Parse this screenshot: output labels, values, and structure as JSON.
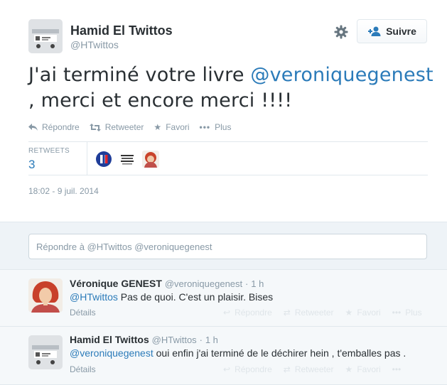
{
  "tweet": {
    "author_name": "Hamid El Twittos",
    "author_handle": "@HTwittos",
    "follow_label": "Suivre",
    "text_before": "J'ai terminé votre livre ",
    "text_mention": "@veroniquegenest",
    "text_after": " , merci et encore merci !!!!",
    "actions": {
      "reply": "Répondre",
      "retweet": "Retweeter",
      "favorite": "Favori",
      "more": "Plus"
    },
    "retweets_label": "RETWEETS",
    "retweets_count": "3",
    "timestamp": "18:02 - 9 juil. 2014"
  },
  "reply_box": {
    "prefix": "Répondre à ",
    "mentions": "@HTwittos @veroniquegenest"
  },
  "replies": [
    {
      "name": "Véronique GENEST",
      "handle": "@veroniquegenest",
      "time": "1 h",
      "mention": "@HTwittos",
      "text": " Pas de quoi. C'est un plaisir. Bises",
      "details": "Détails",
      "actions": {
        "reply": "Répondre",
        "retweet": "Retweeter",
        "favorite": "Favori",
        "more": "Plus"
      }
    },
    {
      "name": "Hamid El Twittos",
      "handle": "@HTwittos",
      "time": "1 h",
      "mention": "@veroniquegenest",
      "text": " oui enfin j'ai terminé de le déchirer hein , t'emballes pas .",
      "details": "Détails",
      "actions": {
        "reply": "Répondre",
        "retweet": "Retweeter",
        "favorite": "Favori"
      }
    }
  ],
  "colors": {
    "link": "#2b7bb9",
    "muted": "#8899a6",
    "text": "#292f33",
    "reply_bg": "#eef3f7"
  }
}
